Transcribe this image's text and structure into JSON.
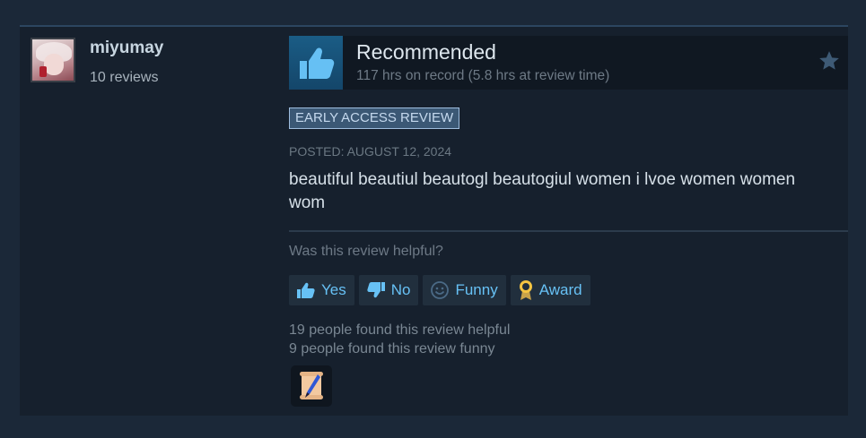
{
  "author": {
    "name": "miyumay",
    "review_count": "10 reviews"
  },
  "review": {
    "verdict": "Recommended",
    "hours": "117 hrs on record (5.8 hrs at review time)",
    "badge": "EARLY ACCESS REVIEW",
    "posted": "POSTED: AUGUST 12, 2024",
    "text": "beautiful beautiul beautogl beautogiul women i lvoe women women wom"
  },
  "feedback": {
    "question": "Was this review helpful?",
    "buttons": {
      "yes": "Yes",
      "no": "No",
      "funny": "Funny",
      "award": "Award"
    },
    "helpful_count": "19 people found this review helpful",
    "funny_count": "9 people found this review funny"
  },
  "icons": {
    "verdict": "thumbs-up-icon",
    "favorite": "star-icon",
    "yes": "thumbs-up-icon",
    "no": "thumbs-down-icon",
    "funny": "smiley-icon",
    "award": "award-ribbon-icon",
    "received_award": "scroll-quill-award-icon"
  },
  "colors": {
    "link": "#67c1f5",
    "recommended": "#66c0f4",
    "badge_bg": "#3b5875"
  }
}
